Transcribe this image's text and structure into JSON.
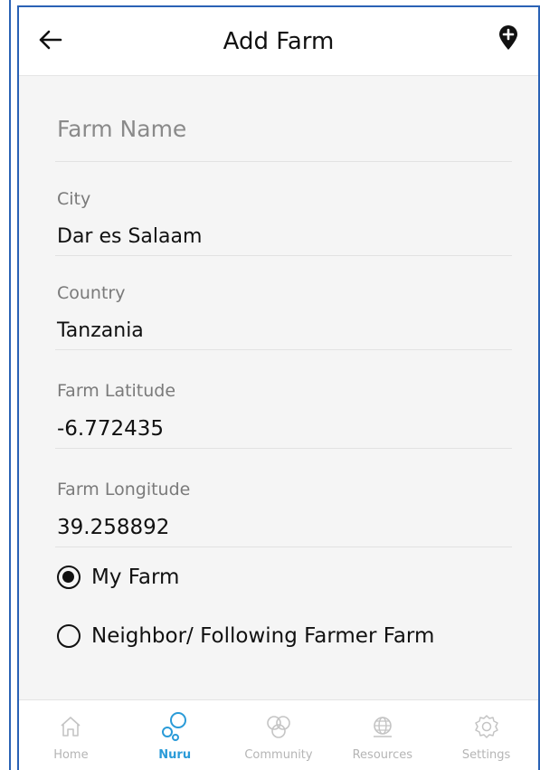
{
  "header": {
    "title": "Add Farm",
    "back_icon": "arrow-left-icon",
    "action_icon": "add-location-icon"
  },
  "form": {
    "farm_name": {
      "placeholder": "Farm Name",
      "value": ""
    },
    "city": {
      "label": "City",
      "value": "Dar es Salaam"
    },
    "country": {
      "label": "Country",
      "value": "Tanzania"
    },
    "latitude": {
      "label": "Farm Latitude",
      "value": "-6.772435"
    },
    "longitude": {
      "label": "Farm Longitude",
      "value": "39.258892"
    }
  },
  "ownership": {
    "options": [
      {
        "label": "My Farm",
        "selected": true
      },
      {
        "label": "Neighbor/ Following Farmer Farm",
        "selected": false
      }
    ]
  },
  "nav": {
    "items": [
      {
        "label": "Home",
        "icon": "home-icon",
        "active": false
      },
      {
        "label": "Nuru",
        "icon": "nuru-bubbles-icon",
        "active": true
      },
      {
        "label": "Community",
        "icon": "community-icon",
        "active": false
      },
      {
        "label": "Resources",
        "icon": "globe-icon",
        "active": false
      },
      {
        "label": "Settings",
        "icon": "gear-icon",
        "active": false
      }
    ]
  },
  "colors": {
    "accent": "#2a9bd8",
    "frame": "#2a62b5",
    "inactive": "#b5b5b5"
  }
}
